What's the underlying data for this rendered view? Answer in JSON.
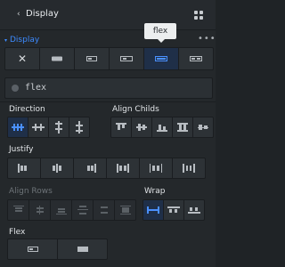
{
  "header": {
    "title": "Display",
    "back_icon": "chevron-left-icon",
    "grid_icon": "grid-icon"
  },
  "display_section": {
    "title": "Display",
    "more_icon": "more-dots-icon",
    "tooltip": "flex",
    "options": [
      {
        "name": "none",
        "icon": "close-icon"
      },
      {
        "name": "block",
        "icon": "block-icon"
      },
      {
        "name": "inline-block",
        "icon": "inline-block-icon"
      },
      {
        "name": "inline",
        "icon": "inline-icon"
      },
      {
        "name": "flex",
        "icon": "flex-icon",
        "active": true
      },
      {
        "name": "inline-flex",
        "icon": "inline-flex-icon"
      }
    ]
  },
  "display_value": "flex",
  "direction": {
    "label": "Direction",
    "options": [
      "row",
      "row-reverse",
      "column",
      "column-reverse"
    ],
    "active_index": 0
  },
  "align_childs": {
    "label": "Align Childs",
    "options": [
      "flex-start",
      "center",
      "flex-end",
      "stretch",
      "baseline"
    ]
  },
  "justify": {
    "label": "Justify",
    "options": [
      "flex-start",
      "center",
      "flex-end",
      "space-between",
      "space-around",
      "space-evenly"
    ]
  },
  "align_rows": {
    "label": "Align Rows",
    "options": [
      "flex-start",
      "center",
      "flex-end",
      "space-between",
      "space-around",
      "stretch"
    ]
  },
  "wrap": {
    "label": "Wrap",
    "options": [
      "nowrap",
      "wrap",
      "wrap-reverse"
    ],
    "active_index": 0
  },
  "flex": {
    "label": "Flex",
    "options": [
      "flex-shrink",
      "flex-grow"
    ]
  },
  "colors": {
    "accent": "#3d8bff",
    "background": "#24282b"
  }
}
